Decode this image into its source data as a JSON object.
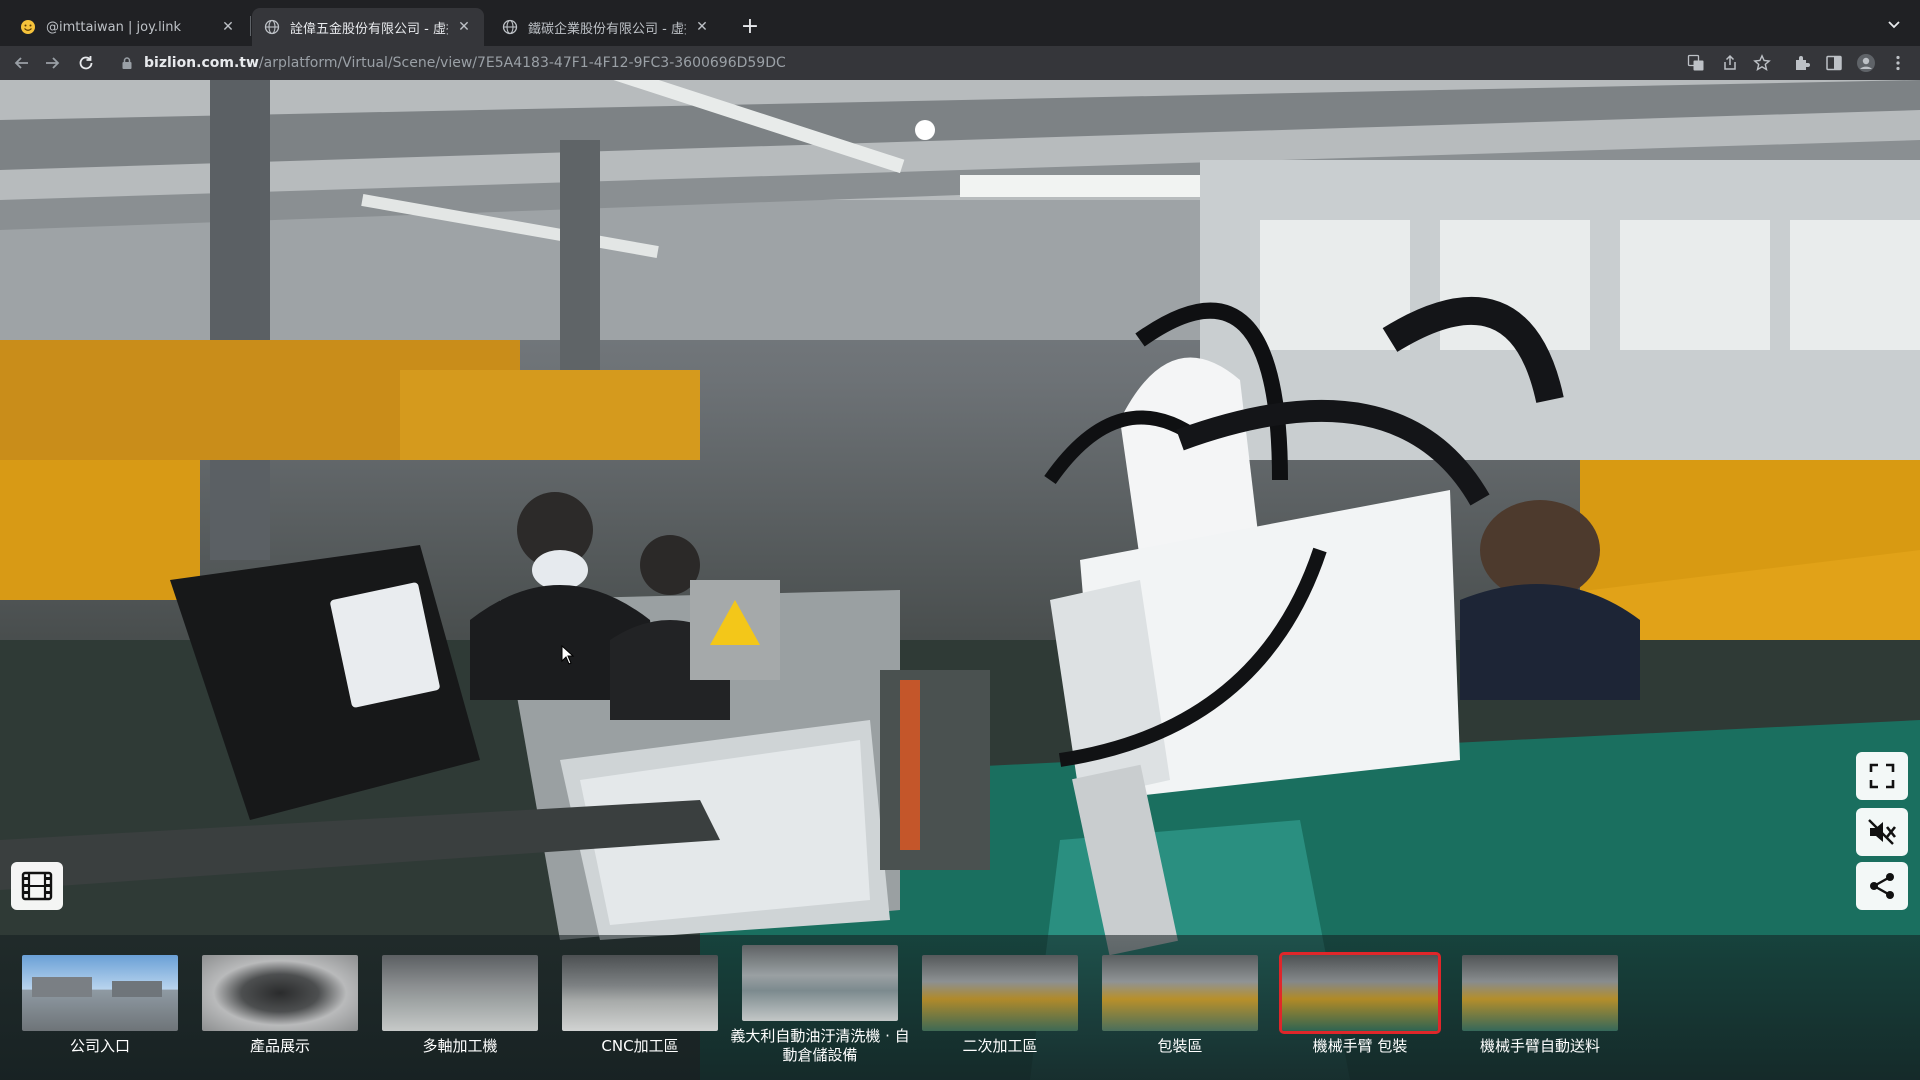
{
  "browser": {
    "tabs": [
      {
        "title": "@imttaiwan | joy.link",
        "favicon": "smiley-emoji-icon"
      },
      {
        "title": "詮偉五金股份有限公司 - 虛擬門",
        "favicon": "globe-icon"
      },
      {
        "title": "鐵碳企業股份有限公司 - 虛擬門",
        "favicon": "globe-icon"
      }
    ],
    "url_host": "bizlion.com.tw",
    "url_path": "/arplatform/Virtual/Scene/view/7E5A4183-47F1-4F12-9FC3-3600696D59DC"
  },
  "viewer": {
    "controls": [
      "fullscreen-icon",
      "mute-icon",
      "share-icon",
      "film-icon"
    ],
    "scenes": [
      {
        "label": "公司入口"
      },
      {
        "label": "產品展示"
      },
      {
        "label": "多軸加工機"
      },
      {
        "label": "CNC加工區"
      },
      {
        "label": "義大利自動油汙清洗機 · 自動倉儲設備"
      },
      {
        "label": "二次加工區"
      },
      {
        "label": "包裝區"
      },
      {
        "label": "機械手臂 包裝"
      },
      {
        "label": "機械手臂自動送料"
      }
    ],
    "selected_scene": "機械手臂 包裝",
    "accent_color": "#e0262a"
  }
}
